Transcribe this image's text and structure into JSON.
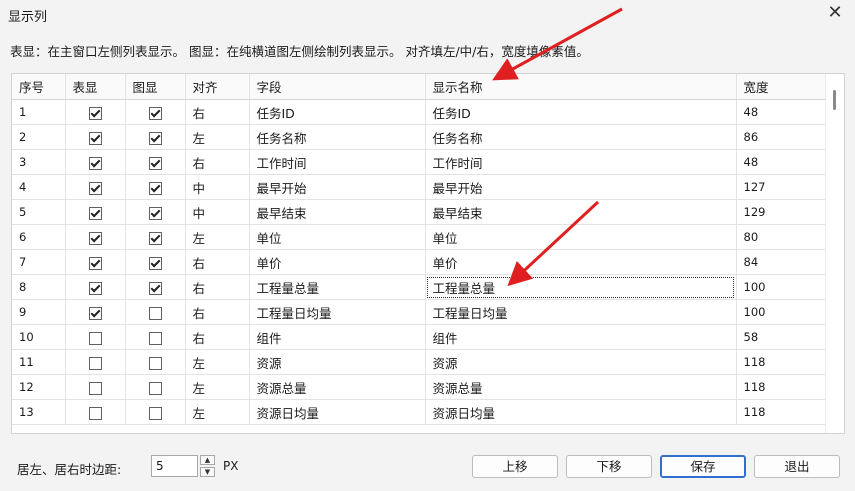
{
  "window": {
    "title": "显示列",
    "close_glyph": "✕"
  },
  "description": "表显：在主窗口左侧列表显示。  图显：在纯横道图左侧绘制列表显示。  对齐填左/中/右，宽度填像素值。",
  "columns": [
    "序号",
    "表显",
    "图显",
    "对齐",
    "字段",
    "显示名称",
    "宽度"
  ],
  "rows": [
    {
      "seq": "1",
      "table_show": true,
      "chart_show": true,
      "align": "右",
      "field": "任务ID",
      "display": "任务ID",
      "width": "48"
    },
    {
      "seq": "2",
      "table_show": true,
      "chart_show": true,
      "align": "左",
      "field": "任务名称",
      "display": "任务名称",
      "width": "86"
    },
    {
      "seq": "3",
      "table_show": true,
      "chart_show": true,
      "align": "右",
      "field": "工作时间",
      "display": "工作时间",
      "width": "48"
    },
    {
      "seq": "4",
      "table_show": true,
      "chart_show": true,
      "align": "中",
      "field": "最早开始",
      "display": "最早开始",
      "width": "127"
    },
    {
      "seq": "5",
      "table_show": true,
      "chart_show": true,
      "align": "中",
      "field": "最早结束",
      "display": "最早结束",
      "width": "129"
    },
    {
      "seq": "6",
      "table_show": true,
      "chart_show": true,
      "align": "左",
      "field": "单位",
      "display": "单位",
      "width": "80"
    },
    {
      "seq": "7",
      "table_show": true,
      "chart_show": true,
      "align": "右",
      "field": "单价",
      "display": "单价",
      "width": "84"
    },
    {
      "seq": "8",
      "table_show": true,
      "chart_show": true,
      "align": "右",
      "field": "工程量总量",
      "display": "工程量总量",
      "width": "100",
      "selected": true
    },
    {
      "seq": "9",
      "table_show": true,
      "chart_show": false,
      "align": "右",
      "field": "工程量日均量",
      "display": "工程量日均量",
      "width": "100"
    },
    {
      "seq": "10",
      "table_show": false,
      "chart_show": false,
      "align": "右",
      "field": "组件",
      "display": "组件",
      "width": "58"
    },
    {
      "seq": "11",
      "table_show": false,
      "chart_show": false,
      "align": "左",
      "field": "资源",
      "display": "资源",
      "width": "118"
    },
    {
      "seq": "12",
      "table_show": false,
      "chart_show": false,
      "align": "左",
      "field": "资源总量",
      "display": "资源总量",
      "width": "118"
    },
    {
      "seq": "13",
      "table_show": false,
      "chart_show": false,
      "align": "左",
      "field": "资源日均量",
      "display": "资源日均量",
      "width": "118"
    }
  ],
  "footer": {
    "margin_label": "居左、居右时边距:",
    "margin_value": "5",
    "unit": "PX",
    "spin_up": "▲",
    "spin_down": "▼",
    "buttons": {
      "up": "上移",
      "down": "下移",
      "save": "保存",
      "exit": "退出"
    }
  },
  "colors": {
    "annotation_arrow": "#e02020",
    "primary_border": "#2f6fd0"
  },
  "icons": {
    "close": "close-icon",
    "checkbox": "checkbox-icon",
    "spin_up": "spin-up-icon",
    "spin_down": "spin-down-icon",
    "arrow": "red-arrow-icon"
  }
}
